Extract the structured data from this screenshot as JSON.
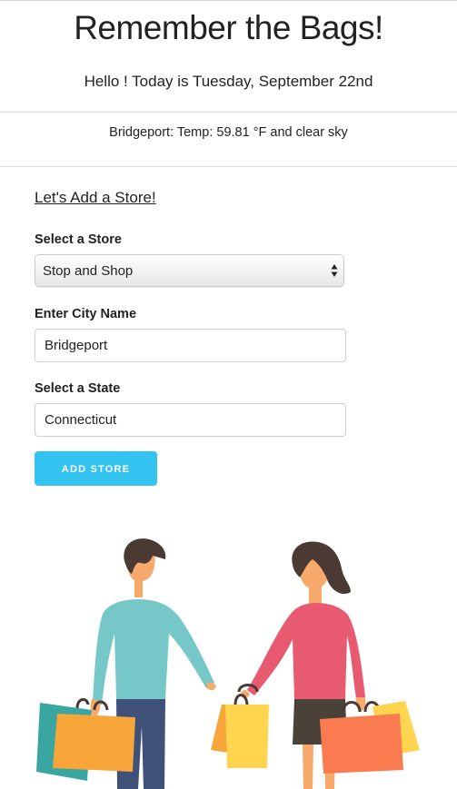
{
  "header": {
    "title": "Remember the Bags!",
    "greeting": "Hello ! Today is Tuesday, September 22nd"
  },
  "weather": {
    "text": "Bridgeport: Temp: 59.81 °F and clear sky"
  },
  "form": {
    "heading": "Let's Add a Store!",
    "store_label": "Select a Store",
    "store_selected": "Stop and Shop",
    "city_label": "Enter City Name",
    "city_value": "Bridgeport",
    "state_label": "Select a State",
    "state_value": "Connecticut",
    "submit_label": "ADD STORE"
  },
  "colors": {
    "button": "#33c3f0",
    "man_shirt": "#76c8c8",
    "woman_shirt": "#e85a70",
    "bag_orange": "#f8a53a",
    "bag_yellow": "#ffd44f",
    "bag_coral": "#fb7b50",
    "bag_teal": "#3aa6a2"
  }
}
